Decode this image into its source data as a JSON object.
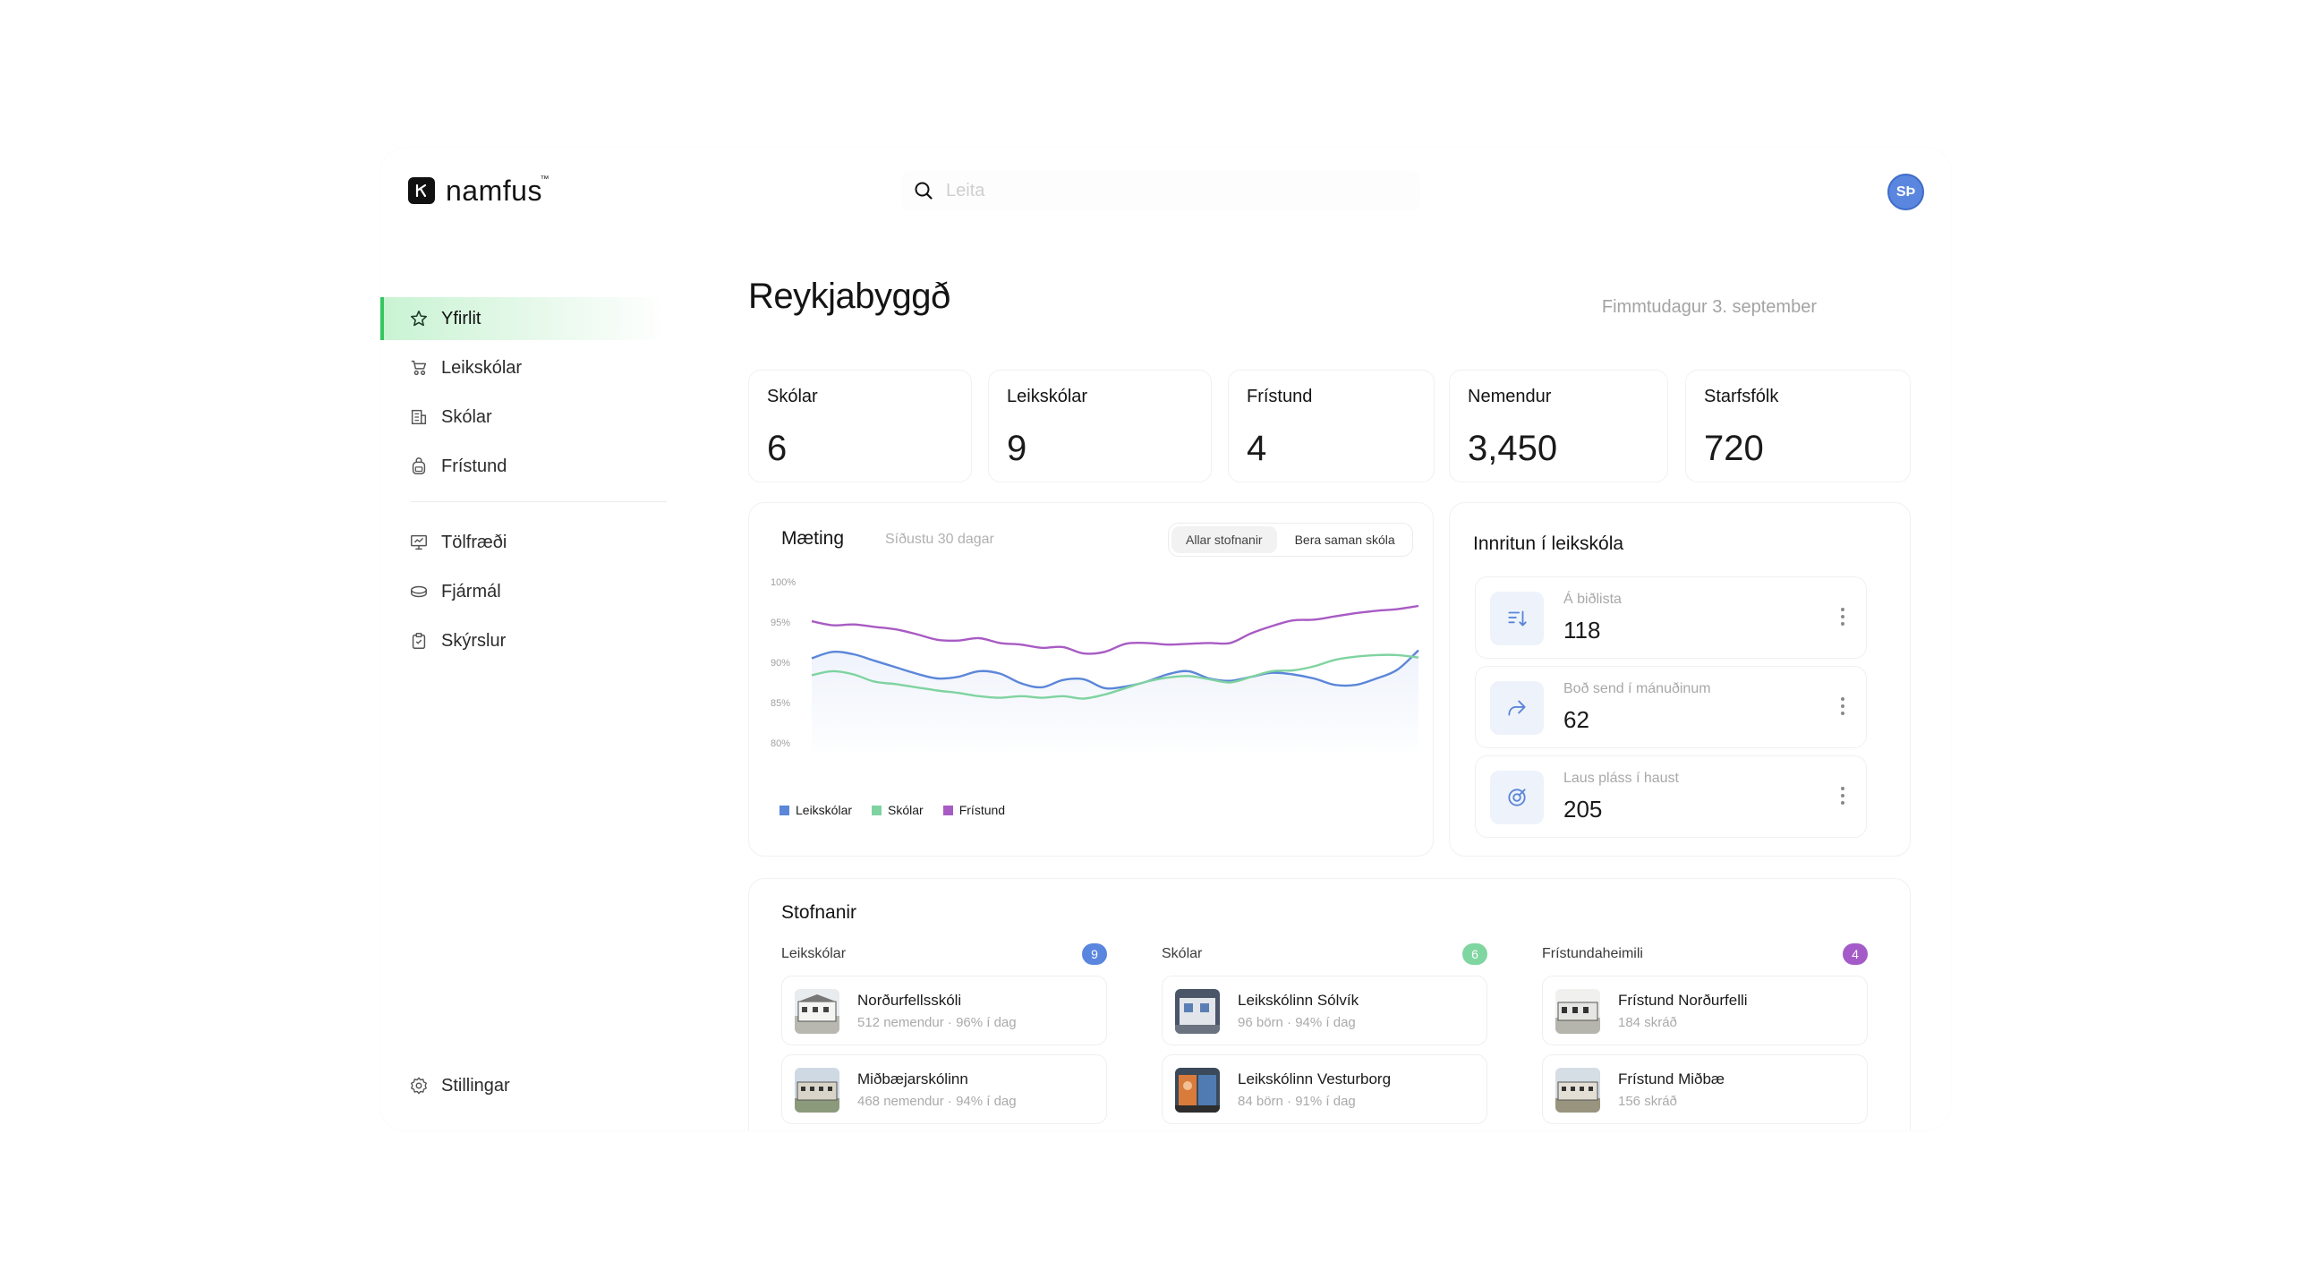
{
  "app": {
    "brand": "namfus",
    "brand_mark": "™"
  },
  "search": {
    "placeholder": "Leita"
  },
  "user": {
    "initials": "SÞ",
    "color": "#5a86e0"
  },
  "sidebar": {
    "items": [
      {
        "label": "Yfirlit",
        "icon": "star-icon",
        "active": true
      },
      {
        "label": "Leikskólar",
        "icon": "stroller-icon"
      },
      {
        "label": "Skólar",
        "icon": "building-icon"
      },
      {
        "label": "Frístund",
        "icon": "backpack-icon"
      },
      {
        "label": "Tölfræði",
        "icon": "presentation-chart-icon"
      },
      {
        "label": "Fjármál",
        "icon": "coins-icon"
      },
      {
        "label": "Skýrslur",
        "icon": "clipboard-check-icon"
      }
    ],
    "settings": {
      "label": "Stillingar",
      "icon": "gear-icon"
    }
  },
  "main": {
    "title": "Reykjabyggð",
    "date": "Fimmtudagur 3. september",
    "stats": [
      {
        "label": "Skólar",
        "value": "6"
      },
      {
        "label": "Leikskólar",
        "value": "9"
      },
      {
        "label": "Frístund",
        "value": "4"
      },
      {
        "label": "Nemendur",
        "value": "3,450"
      },
      {
        "label": "Starfsfólk",
        "value": "720"
      }
    ],
    "attendance": {
      "title": "Mæting",
      "subtitle": "Síðustu 30 dagar",
      "toggle": {
        "options": [
          "Allar stofnanir",
          "Bera saman skóla"
        ],
        "selected": "Allar stofnanir"
      }
    },
    "enrollment": {
      "title": "Innritun í leikskóla",
      "rows": [
        {
          "label": "Á biðlista",
          "value": "118",
          "icon": "sort-arrow-icon"
        },
        {
          "label": "Boð send í mánuðinum",
          "value": "62",
          "icon": "share-arrow-icon"
        },
        {
          "label": "Laus pláss í haust",
          "value": "205",
          "icon": "target-icon"
        }
      ]
    },
    "institutions": {
      "title": "Stofnanir",
      "columns": [
        {
          "title": "Leikskólar",
          "count": "9",
          "color": "#5a86e0",
          "items": [
            {
              "name": "Norðurfellsskóli",
              "meta": "512 nemendur · 96% í dag",
              "icon": "school-photo-icon"
            },
            {
              "name": "Miðbæjarskólinn",
              "meta": "468 nemendur · 94% í dag",
              "icon": "school-photo-icon"
            }
          ]
        },
        {
          "title": "Skólar",
          "count": "6",
          "color": "#7fd6a0",
          "items": [
            {
              "name": "Leikskólinn Sólvík",
              "meta": "96 börn · 94% í dag",
              "icon": "preschool-photo-icon"
            },
            {
              "name": "Leikskólinn Vesturborg",
              "meta": "84 börn · 91% í dag",
              "icon": "preschool-photo-icon"
            }
          ]
        },
        {
          "title": "Frístundaheimili",
          "count": "4",
          "color": "#a45bc7",
          "items": [
            {
              "name": "Frístund Norðurfelli",
              "meta": "184 skráð",
              "icon": "building-photo-icon"
            },
            {
              "name": "Frístund Miðbæ",
              "meta": "156 skráð",
              "icon": "building-photo-icon"
            }
          ]
        }
      ]
    }
  },
  "chart_data": {
    "type": "line",
    "title": "Mæting",
    "subtitle": "Síðustu 30 dagar",
    "yticks": [
      "100%",
      "95%",
      "90%",
      "85%",
      "80%"
    ],
    "ylim": [
      80,
      100
    ],
    "legend_position": "bottom-left",
    "x": [
      1,
      2,
      3,
      4,
      5,
      6,
      7,
      8,
      9,
      10,
      11,
      12,
      13,
      14,
      15,
      16,
      17,
      18,
      19,
      20,
      21,
      22,
      23,
      24,
      25,
      26,
      27,
      28,
      29,
      30
    ],
    "series": [
      {
        "name": "Leikskólar",
        "color": "#5b86d9",
        "values": [
          90.5,
          91.3,
          91.0,
          90.2,
          89.4,
          88.6,
          88.0,
          88.2,
          88.9,
          88.6,
          87.4,
          86.9,
          87.8,
          87.9,
          86.8,
          87.0,
          87.6,
          88.5,
          88.9,
          88.0,
          87.7,
          88.2,
          88.7,
          88.5,
          88.0,
          87.2,
          87.2,
          88.0,
          89.1,
          91.5
        ]
      },
      {
        "name": "Skólar",
        "color": "#7fd3a0",
        "values": [
          88.4,
          88.9,
          88.5,
          87.6,
          87.3,
          86.9,
          86.5,
          86.2,
          85.8,
          85.6,
          85.8,
          85.6,
          85.8,
          85.5,
          86.0,
          86.8,
          87.6,
          88.1,
          88.3,
          87.9,
          87.5,
          88.2,
          88.9,
          89.0,
          89.5,
          90.3,
          90.7,
          90.9,
          90.9,
          90.6
        ]
      },
      {
        "name": "Frístund",
        "color": "#a85bc4",
        "values": [
          95.1,
          94.6,
          94.7,
          94.4,
          94.1,
          93.5,
          92.8,
          92.7,
          93.0,
          92.4,
          92.2,
          91.8,
          91.9,
          91.1,
          91.3,
          92.3,
          92.4,
          92.2,
          92.3,
          92.4,
          92.4,
          93.6,
          94.5,
          95.2,
          95.3,
          95.7,
          96.1,
          96.4,
          96.6,
          97.0
        ]
      }
    ]
  }
}
